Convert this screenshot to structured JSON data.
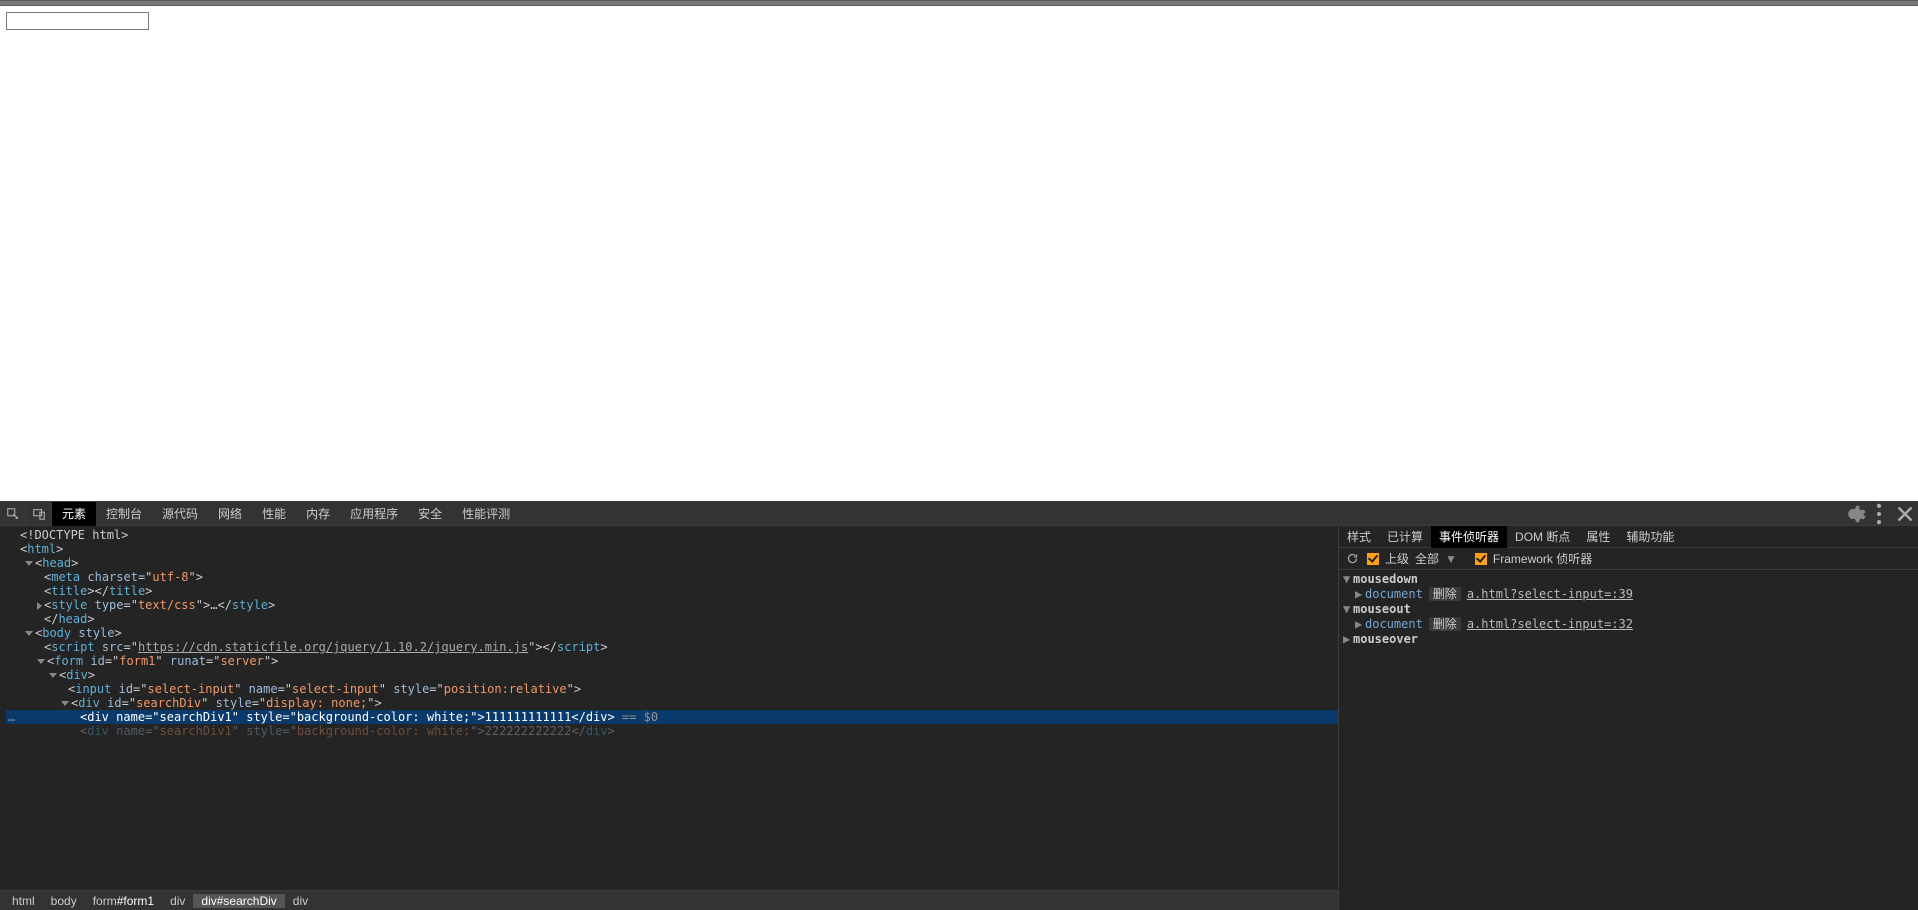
{
  "page": {
    "input_value": ""
  },
  "devtools": {
    "tabs": [
      "元素",
      "控制台",
      "源代码",
      "网络",
      "性能",
      "内存",
      "应用程序",
      "安全",
      "性能评测"
    ],
    "selected_tab": 0,
    "side_tabs": [
      "样式",
      "已计算",
      "事件侦听器",
      "DOM 断点",
      "属性",
      "辅助功能"
    ],
    "side_selected": 2,
    "filter": {
      "ancestor": "上级",
      "all": "全部",
      "framework": "Framework 侦听器"
    },
    "breadcrumb": [
      "html",
      "body",
      "form#form1",
      "div",
      "div#searchDiv",
      "div"
    ],
    "breadcrumb_sel": 4
  },
  "dom_lines": [
    {
      "indent": 0,
      "arrow": "",
      "html": "<span class='pun'>&lt;!DOCTYPE html&gt;</span>"
    },
    {
      "indent": 0,
      "arrow": "",
      "html": "<span class='pun'>&lt;</span><span class='tag'>html</span><span class='pun'>&gt;</span>"
    },
    {
      "indent": 1,
      "arrow": "d",
      "html": "<span class='pun'>&lt;</span><span class='tag'>head</span><span class='pun'>&gt;</span>"
    },
    {
      "indent": 2,
      "arrow": "",
      "html": "<span class='pun'>&lt;</span><span class='tag'>meta</span> <span class='attrn'>charset</span><span class='pun'>=\"</span><span class='attrv'>utf-8</span><span class='pun'>\"&gt;</span>"
    },
    {
      "indent": 2,
      "arrow": "",
      "html": "<span class='pun'>&lt;</span><span class='tag'>title</span><span class='pun'>&gt;&lt;/</span><span class='tag'>title</span><span class='pun'>&gt;</span>"
    },
    {
      "indent": 2,
      "arrow": "r",
      "html": "<span class='pun'>&lt;</span><span class='tag'>style</span> <span class='attrn'>type</span><span class='pun'>=\"</span><span class='attrv'>text/css</span><span class='pun'>\"&gt;</span><span class='txt'>…</span><span class='pun'>&lt;/</span><span class='tag'>style</span><span class='pun'>&gt;</span>"
    },
    {
      "indent": 2,
      "arrow": "",
      "html": "<span class='pun'>&lt;/</span><span class='tag'>head</span><span class='pun'>&gt;</span>"
    },
    {
      "indent": 1,
      "arrow": "d",
      "html": "<span class='pun'>&lt;</span><span class='tag'>body</span> <span class='attrn'>style</span><span class='pun'>&gt;</span>"
    },
    {
      "indent": 2,
      "arrow": "",
      "html": "<span class='pun'>&lt;</span><span class='tag'>script</span> <span class='attrn'>src</span><span class='pun'>=\"</span><span class='jsurl'>https://cdn.staticfile.org/jquery/1.10.2/jquery.min.js</span><span class='pun'>\"&gt;&lt;/</span><span class='tag'>script</span><span class='pun'>&gt;</span>"
    },
    {
      "indent": 2,
      "arrow": "d",
      "html": "<span class='pun'>&lt;</span><span class='tag'>form</span> <span class='attrn'>id</span><span class='pun'>=\"</span><span class='attrv'>form1</span><span class='pun'>\"</span> <span class='attrn'>runat</span><span class='pun'>=\"</span><span class='attrv'>server</span><span class='pun'>\"&gt;</span>"
    },
    {
      "indent": 3,
      "arrow": "d",
      "html": "<span class='pun'>&lt;</span><span class='tag'>div</span><span class='pun'>&gt;</span>"
    },
    {
      "indent": 4,
      "arrow": "",
      "html": "<span class='pun'>&lt;</span><span class='tag'>input</span> <span class='attrn'>id</span><span class='pun'>=\"</span><span class='attrv'>select-input</span><span class='pun'>\"</span> <span class='attrn'>name</span><span class='pun'>=\"</span><span class='attrv'>select-input</span><span class='pun'>\"</span> <span class='attrn'>style</span><span class='pun'>=\"</span><span class='attrv'>position:relative</span><span class='pun'>\"&gt;</span>"
    },
    {
      "indent": 4,
      "arrow": "d",
      "html": "<span class='pun'>&lt;</span><span class='tag'>div</span> <span class='attrn'>id</span><span class='pun'>=\"</span><span class='attrv'>searchDiv</span><span class='pun'>\"</span> <span class='attrn'>style</span><span class='pun'>=\"</span><span class='attrv'>display: none;</span><span class='pun'>\"&gt;</span>"
    },
    {
      "indent": 5,
      "arrow": "",
      "sel": true,
      "gutter": "…",
      "html": "<span class='pun'>&lt;</span><span class='tag'>div</span> <span class='attrn'>name</span><span class='pun'>=\"</span><span class='attrv'>searchDiv1</span><span class='pun'>\"</span> <span class='attrn'>style</span><span class='pun'>=\"</span><span class='attrv'>background-color: white;</span><span class='pun'>\"&gt;</span><span class='txt'>111111111111</span><span class='pun'>&lt;/</span><span class='tag'>div</span><span class='pun'>&gt;</span> <span class='sel0'>== $0</span>"
    },
    {
      "indent": 5,
      "arrow": "",
      "dim": true,
      "html": "<span class='pun'>&lt;</span><span class='tag'>div</span> <span class='attrn'>name</span><span class='pun'>=\"</span><span class='attrv'>searchDiv1</span><span class='pun'>\"</span> <span class='attrn'>style</span><span class='pun'>=\"</span><span class='attrv'>background-color: white;</span><span class='pun'>\"&gt;</span><span class='txt'>222222222222</span><span class='pun'>&lt;/</span><span class='tag'>div</span><span class='pun'>&gt;</span>"
    }
  ],
  "listeners": {
    "groups": [
      {
        "name": "mousedown",
        "open": true,
        "items": [
          {
            "target": "document",
            "remove": "删除",
            "link": "a.html?select-input=:39"
          }
        ]
      },
      {
        "name": "mouseout",
        "open": true,
        "items": [
          {
            "target": "document",
            "remove": "删除",
            "link": "a.html?select-input=:32"
          }
        ]
      },
      {
        "name": "mouseover",
        "open": false,
        "items": []
      }
    ]
  }
}
